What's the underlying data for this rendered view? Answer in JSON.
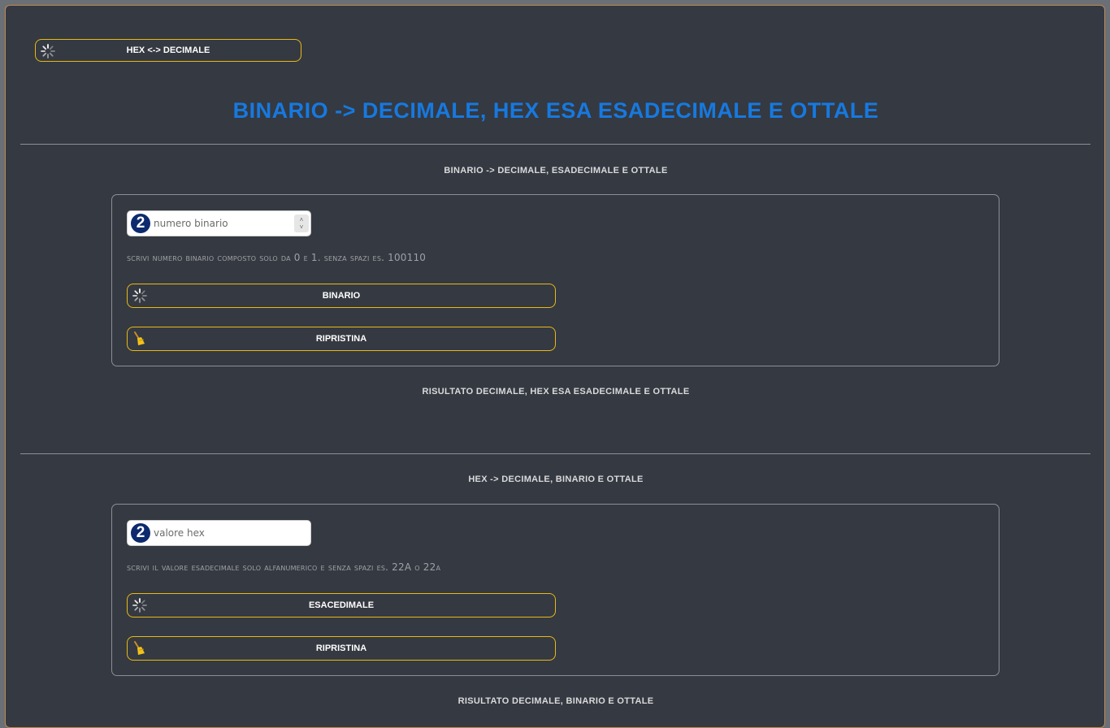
{
  "top_button": {
    "label": "HEX <-> DECIMALE",
    "icon": "spinner-icon"
  },
  "page_title": "BINARIO -> DECIMALE, HEX ESA ESADECIMALE E OTTALE",
  "section_binary": {
    "heading": "BINARIO -> DECIMALE, ESADECIMALE E OTTALE",
    "badge": "2",
    "input_placeholder": "numero binario",
    "input_value": "",
    "hint": "scrivi numero binario composto solo da 0 e 1. senza spazi es. 100110",
    "convert_label": "BINARIO",
    "reset_label": "RIPRISTINA",
    "result_heading": "RISULTATO DECIMALE, HEX ESA ESADECIMALE E OTTALE"
  },
  "section_hex": {
    "heading": "HEX -> DECIMALE, BINARIO E OTTALE",
    "badge": "2",
    "input_placeholder": "valore hex",
    "input_value": "",
    "hint": "scrivi il valore esadecimale solo alfanumerico e senza spazi es. 22A o 22a",
    "convert_label": "ESACEDIMALE",
    "reset_label": "RIPRISTINA",
    "result_heading": "RISULTATO DECIMALE, BINARIO E OTTALE"
  },
  "colors": {
    "accent": "#e8b915",
    "title": "#1679e0",
    "background": "#353941",
    "badge": "#0d2a6e"
  }
}
